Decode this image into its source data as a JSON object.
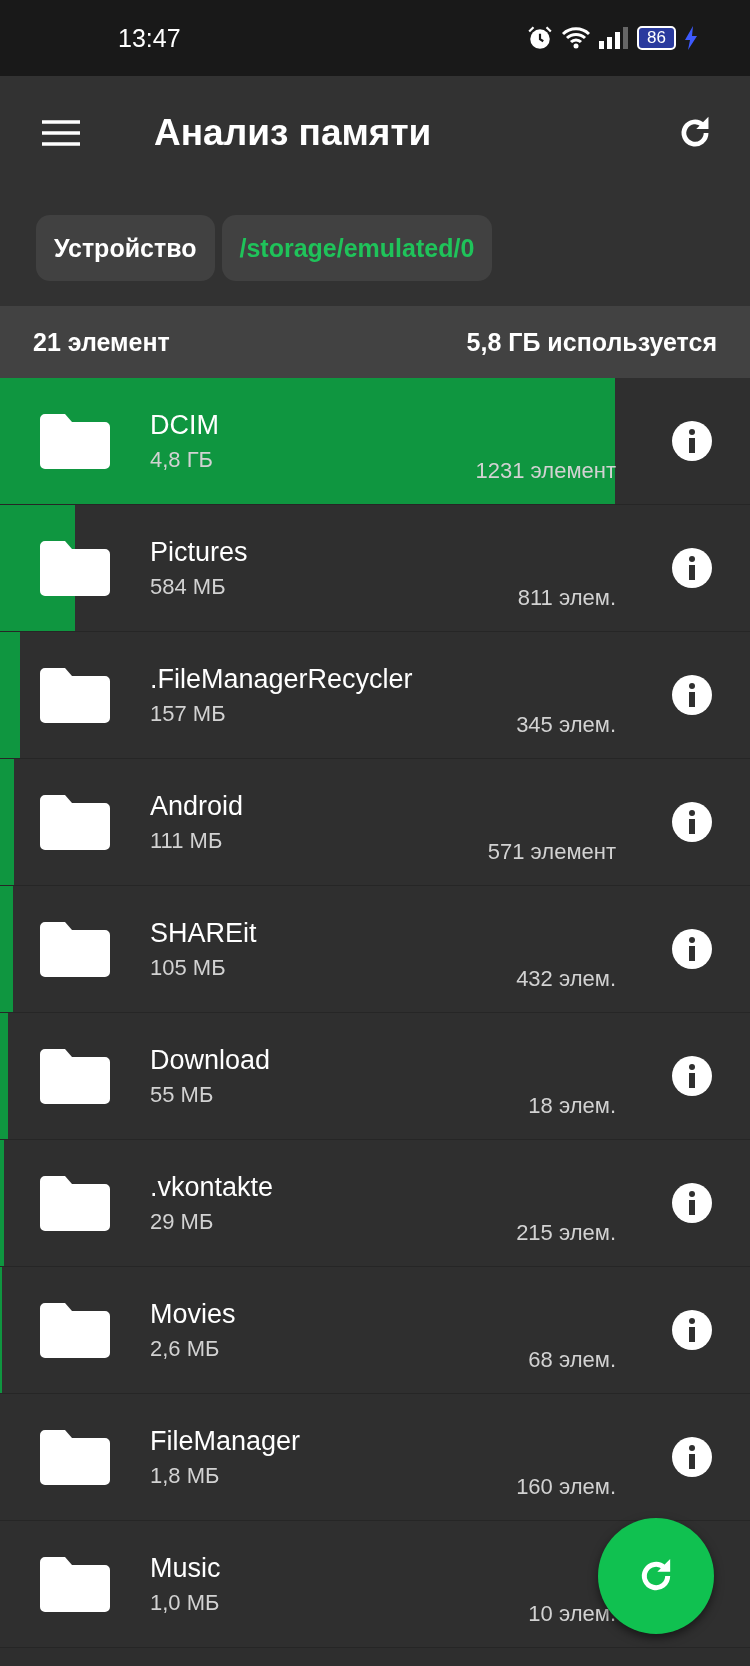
{
  "status_bar": {
    "time": "13:47",
    "battery": "86"
  },
  "toolbar": {
    "title": "Анализ памяти"
  },
  "breadcrumbs": [
    {
      "label": "Устройство",
      "selected": false
    },
    {
      "label": "/storage/emulated/0",
      "selected": true
    }
  ],
  "summary": {
    "count": "21 элемент",
    "used": "5,8 ГБ используется"
  },
  "folders": [
    {
      "name": "DCIM",
      "size": "4,8 ГБ",
      "items": "1231 элемент",
      "level": 0.82
    },
    {
      "name": "Pictures",
      "size": "584 МБ",
      "items": "811 элем.",
      "level": 0.1
    },
    {
      "name": ".FileManagerRecycler",
      "size": "157 МБ",
      "items": "345 элем.",
      "level": 0.027
    },
    {
      "name": "Android",
      "size": "111 МБ",
      "items": "571 элемент",
      "level": 0.018
    },
    {
      "name": "SHAREit",
      "size": "105 МБ",
      "items": "432 элем.",
      "level": 0.017
    },
    {
      "name": "Download",
      "size": "55 МБ",
      "items": "18 элем.",
      "level": 0.01
    },
    {
      "name": ".vkontakte",
      "size": "29 МБ",
      "items": "215 элем.",
      "level": 0.005
    },
    {
      "name": "Movies",
      "size": "2,6 МБ",
      "items": "68 элем.",
      "level": 0.002
    },
    {
      "name": "FileManager",
      "size": "1,8 МБ",
      "items": "160 элем."
    },
    {
      "name": "Music",
      "size": "1,0 МБ",
      "items": "10 элем."
    }
  ]
}
